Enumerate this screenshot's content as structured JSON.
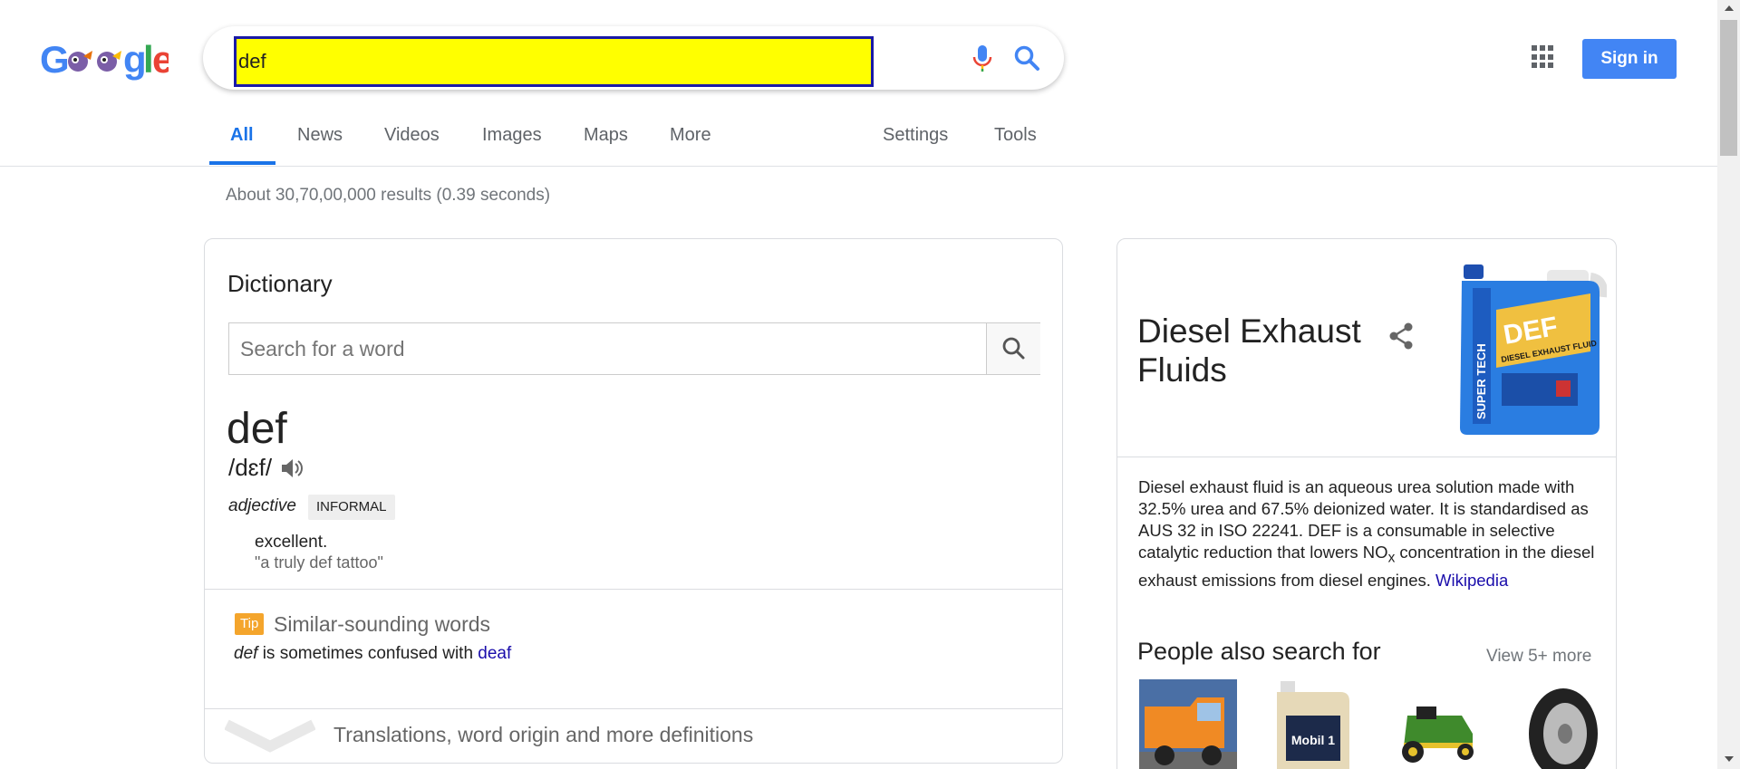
{
  "search": {
    "query": "def"
  },
  "header": {
    "sign_in_label": "Sign in"
  },
  "tabs": [
    {
      "label": "All"
    },
    {
      "label": "News"
    },
    {
      "label": "Videos"
    },
    {
      "label": "Images"
    },
    {
      "label": "Maps"
    },
    {
      "label": "More"
    },
    {
      "label": "Settings"
    },
    {
      "label": "Tools"
    }
  ],
  "results_stats": "About 30,70,00,000 results (0.39 seconds)",
  "dictionary": {
    "title": "Dictionary",
    "search_placeholder": "Search for a word",
    "word": "def",
    "phonetic": "/dɛf/",
    "part_of_speech": "adjective",
    "register_badge": "INFORMAL",
    "definition": "excellent.",
    "example": "\"a truly def tattoo\"",
    "tip_badge": "Tip",
    "similar_title": "Similar-sounding words",
    "similar_word": "def",
    "similar_middle": " is sometimes confused with ",
    "similar_link": "deaf",
    "more_definitions": "Translations, word origin and more definitions"
  },
  "knowledge_panel": {
    "title": "Diesel Exhaust Fluids",
    "description_1": "Diesel exhaust fluid is an aqueous urea solution made with 32.5% urea and 67.5% deionized water. It is standardised as AUS 32 in ISO 22241. DEF is a consumable in selective catalytic reduction that lowers NO",
    "description_sub": "x",
    "description_2": " concentration in the diesel exhaust emissions from diesel engines. ",
    "source_link": "Wikipedia",
    "people_also_search": "People also search for",
    "view_more": "View 5+ more",
    "jug_brand": "SUPER TECH",
    "jug_label": "DEF",
    "jug_sublabel": "DIESEL EXHAUST FLUID",
    "oil_label": "Mobil 1"
  },
  "colors": {
    "accent": "#1a73e8",
    "sign_in": "#4285f4",
    "link": "#1a0dab",
    "query_highlight": "#ffff00",
    "tip": "#f4a52c"
  }
}
